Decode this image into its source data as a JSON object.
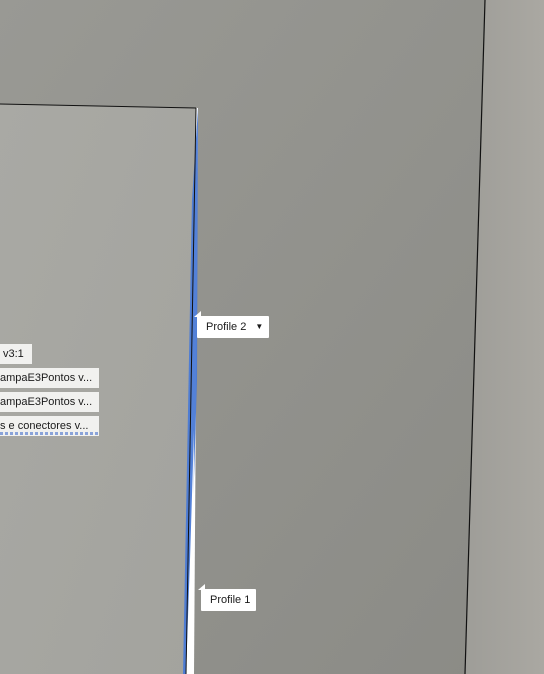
{
  "labels": [
    {
      "id": "version",
      "text": "v3:1"
    },
    {
      "id": "item1",
      "text": "ampaE3Pontos v..."
    },
    {
      "id": "item2",
      "text": "ampaE3Pontos v..."
    },
    {
      "id": "item3",
      "text": "s e conectores v..."
    }
  ],
  "callouts": {
    "profile2": {
      "text": "Profile 2",
      "dropdown": true
    },
    "profile1": {
      "text": "Profile 1"
    }
  },
  "colors": {
    "panel_front": "#a7a7a2",
    "panel_back": "#8f8f8a",
    "edge_blue": "#4a7ad6",
    "edge_black": "#111111"
  }
}
